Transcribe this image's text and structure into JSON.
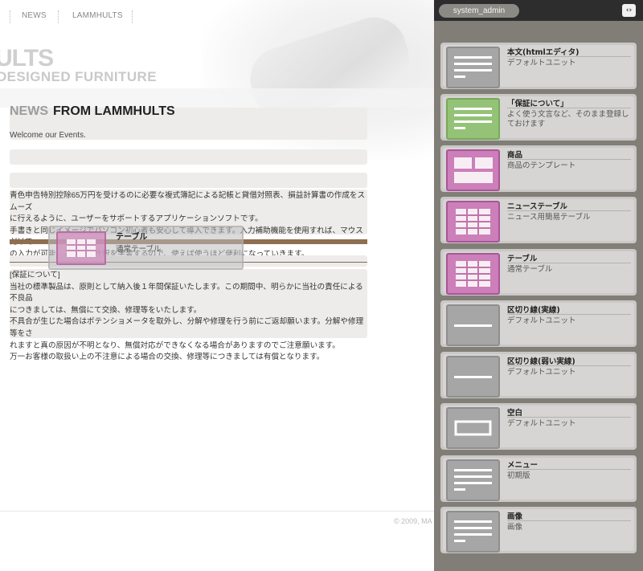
{
  "site": {
    "nav": [
      "NEWS",
      "LAMMHULTS"
    ],
    "logo_big": "ULTS",
    "logo_sub": "DESIGNED FURNITURE",
    "news_heading_a": "NEWS",
    "news_heading_b": "FROM LAMMHULTS",
    "welcome": "Welcome our Events.",
    "paragraph1": [
      "青色申告特別控除65万円を受けるのに必要な複式簿記による記帳と貸借対照表、損益計算書の作成をスムーズ",
      "に行えるように、ユーザーをサポートするアプリケーションソフトです。",
      "手書きと同じイメージでパソコン初心者も安心して導入できます。入力補助機能を使用すれば、マウスだけで",
      "の入力が可能。入力した仕訳を学習するので、使えば使うほど便利になっていきます。"
    ],
    "paragraph2": [
      "[保証について]",
      "当社の標準製品は、原則として納入後１年間保証いたします。この期間中、明らかに当社の責任による不良品",
      "につきましては、無償にて交換、修理等をいたします。",
      "不具合が生じた場合はポテンショメータを取外し、分解や修理を行う前にご返却願います。分解や修理等をさ",
      "れますと真の原因が不明となり、無償対応ができなくなる場合がありますのでご注意願います。",
      "万一お客様の取扱い上の不注意による場合の交換、修理等につきましては有償となります。"
    ],
    "dragging": {
      "title": "テーブル",
      "desc": "通常テーブル",
      "thumb": "table-icon"
    },
    "copyright": "© 2009, MA"
  },
  "panel": {
    "user": "system_admin",
    "toggle": "‹›",
    "colors": {
      "gray": "#a6a6a6",
      "green": "#94c277",
      "pink": "#cc7fb9"
    },
    "units": [
      {
        "title": "本文(htmlエディタ)",
        "desc": "デフォルトユニット",
        "thumb": "text",
        "color": "gray"
      },
      {
        "title": "「保証について」",
        "desc": "よく使う文言など、そのまま登録しておけます",
        "thumb": "text",
        "color": "green"
      },
      {
        "title": "商品",
        "desc": "商品のテンプレート",
        "thumb": "product",
        "color": "pink"
      },
      {
        "title": "ニューステーブル",
        "desc": "ニュース用簡易テーブル",
        "thumb": "table",
        "color": "pink"
      },
      {
        "title": "テーブル",
        "desc": "通常テーブル",
        "thumb": "table",
        "color": "pink"
      },
      {
        "title": "区切り線(実線)",
        "desc": "デフォルトユニット",
        "thumb": "line",
        "color": "gray"
      },
      {
        "title": "区切り線(弱い実線)",
        "desc": "デフォルトユニット",
        "thumb": "line",
        "color": "gray"
      },
      {
        "title": "空白",
        "desc": "デフォルトユニット",
        "thumb": "blank",
        "color": "gray"
      },
      {
        "title": "メニュー",
        "desc": "初期版",
        "thumb": "text",
        "color": "gray"
      },
      {
        "title": "画像",
        "desc": "画像",
        "thumb": "text",
        "color": "gray"
      }
    ]
  }
}
